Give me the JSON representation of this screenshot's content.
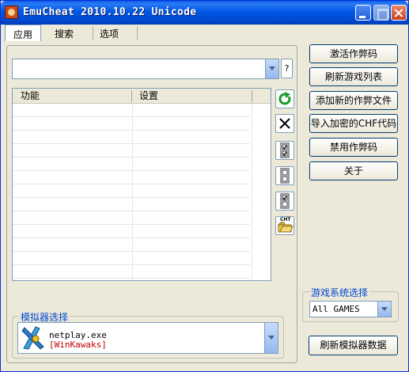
{
  "window": {
    "title": "EmuCheat 2010.10.22 Unicode"
  },
  "tabs": [
    {
      "label": "应用",
      "active": true
    },
    {
      "label": "搜索"
    },
    {
      "label": "选项"
    }
  ],
  "cheat_combo": {
    "value": ""
  },
  "help": {
    "label": "?"
  },
  "list": {
    "columns": [
      "功能",
      "设置"
    ],
    "rows": []
  },
  "side_tools": [
    {
      "icon": "refresh-icon"
    },
    {
      "icon": "delete-icon"
    },
    {
      "icon": "check-all-icon"
    },
    {
      "icon": "uncheck-all-icon"
    },
    {
      "icon": "toggle-check-icon"
    },
    {
      "icon": "open-chf-file-icon",
      "label": "CHT"
    }
  ],
  "buttons": [
    {
      "label": "激活作弊码"
    },
    {
      "label": "刷新游戏列表"
    },
    {
      "label": "添加新的作弊文件"
    },
    {
      "label": "导入加密的CHF代码"
    },
    {
      "label": "禁用作弊码"
    },
    {
      "label": "关于"
    }
  ],
  "system_group": {
    "title": "游戏系统选择",
    "selected": "All GAMES"
  },
  "emulator_group": {
    "title": "模拟器选择",
    "exe": "netplay.exe",
    "name": "[WinKawaks]"
  },
  "refresh_emulator": {
    "label": "刷新模拟器数据"
  },
  "colors": {
    "titlebar": "#0058E6",
    "window_bg": "#ECE9D8",
    "group_title": "#0046D5",
    "emulator_name": "#C00000"
  }
}
